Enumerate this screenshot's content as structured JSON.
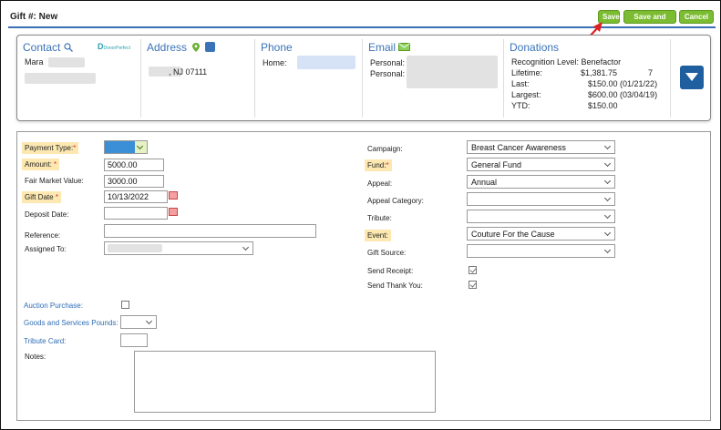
{
  "header": {
    "title": "Gift #: New",
    "save_label": "Save",
    "save_exit_label": "Save and Exit",
    "cancel_label": "Cancel"
  },
  "contact": {
    "heading": "Contact",
    "first_name": "Mara",
    "logo_text": "DonorPerfect"
  },
  "address": {
    "heading": "Address",
    "line2": ", NJ 07111"
  },
  "phone": {
    "heading": "Phone",
    "home_label": "Home:"
  },
  "email": {
    "heading": "Email",
    "personal_label_1": "Personal:",
    "personal_label_2": "Personal:"
  },
  "donations": {
    "heading": "Donations",
    "recognition": "Recognition Level: Benefactor",
    "lifetime_label": "Lifetime:",
    "lifetime_value": "$1,381.75",
    "lifetime_count": "7",
    "last_label": "Last:",
    "last_value": "$150.00 (01/21/22)",
    "largest_label": "Largest:",
    "largest_value": "$600.00 (03/04/19)",
    "ytd_label": "YTD:",
    "ytd_value": "$150.00"
  },
  "form": {
    "payment_type_label": "Payment Type:",
    "amount_label": "Amount:",
    "amount_value": "5000.00",
    "fmv_label": "Fair Market Value:",
    "fmv_value": "3000.00",
    "gift_date_label": "Gift Date",
    "gift_date_value": "10/13/2022",
    "deposit_date_label": "Deposit Date:",
    "reference_label": "Reference:",
    "assigned_to_label": "Assigned To:",
    "campaign_label": "Campaign:",
    "campaign_value": "Breast Cancer Awareness",
    "fund_label": "Fund:",
    "fund_value": "General Fund",
    "appeal_label": "Appeal:",
    "appeal_value": "Annual",
    "appeal_category_label": "Appeal Category:",
    "tribute_label": "Tribute:",
    "event_label": "Event:",
    "event_value": "Couture For the Cause",
    "gift_source_label": "Gift Source:",
    "send_receipt_label": "Send Receipt:",
    "send_thank_you_label": "Send Thank You:",
    "auction_purchase_label": "Auction Purchase:",
    "goods_services_label": "Goods and Services Pounds:",
    "tribute_card_label": "Tribute Card:",
    "notes_label": "Notes:",
    "required_marker": "*"
  },
  "colors": {
    "accent": "#7cbc32",
    "link": "#3b73b9",
    "highlight": "#fce8b0",
    "toggle": "#1f5fa0"
  }
}
